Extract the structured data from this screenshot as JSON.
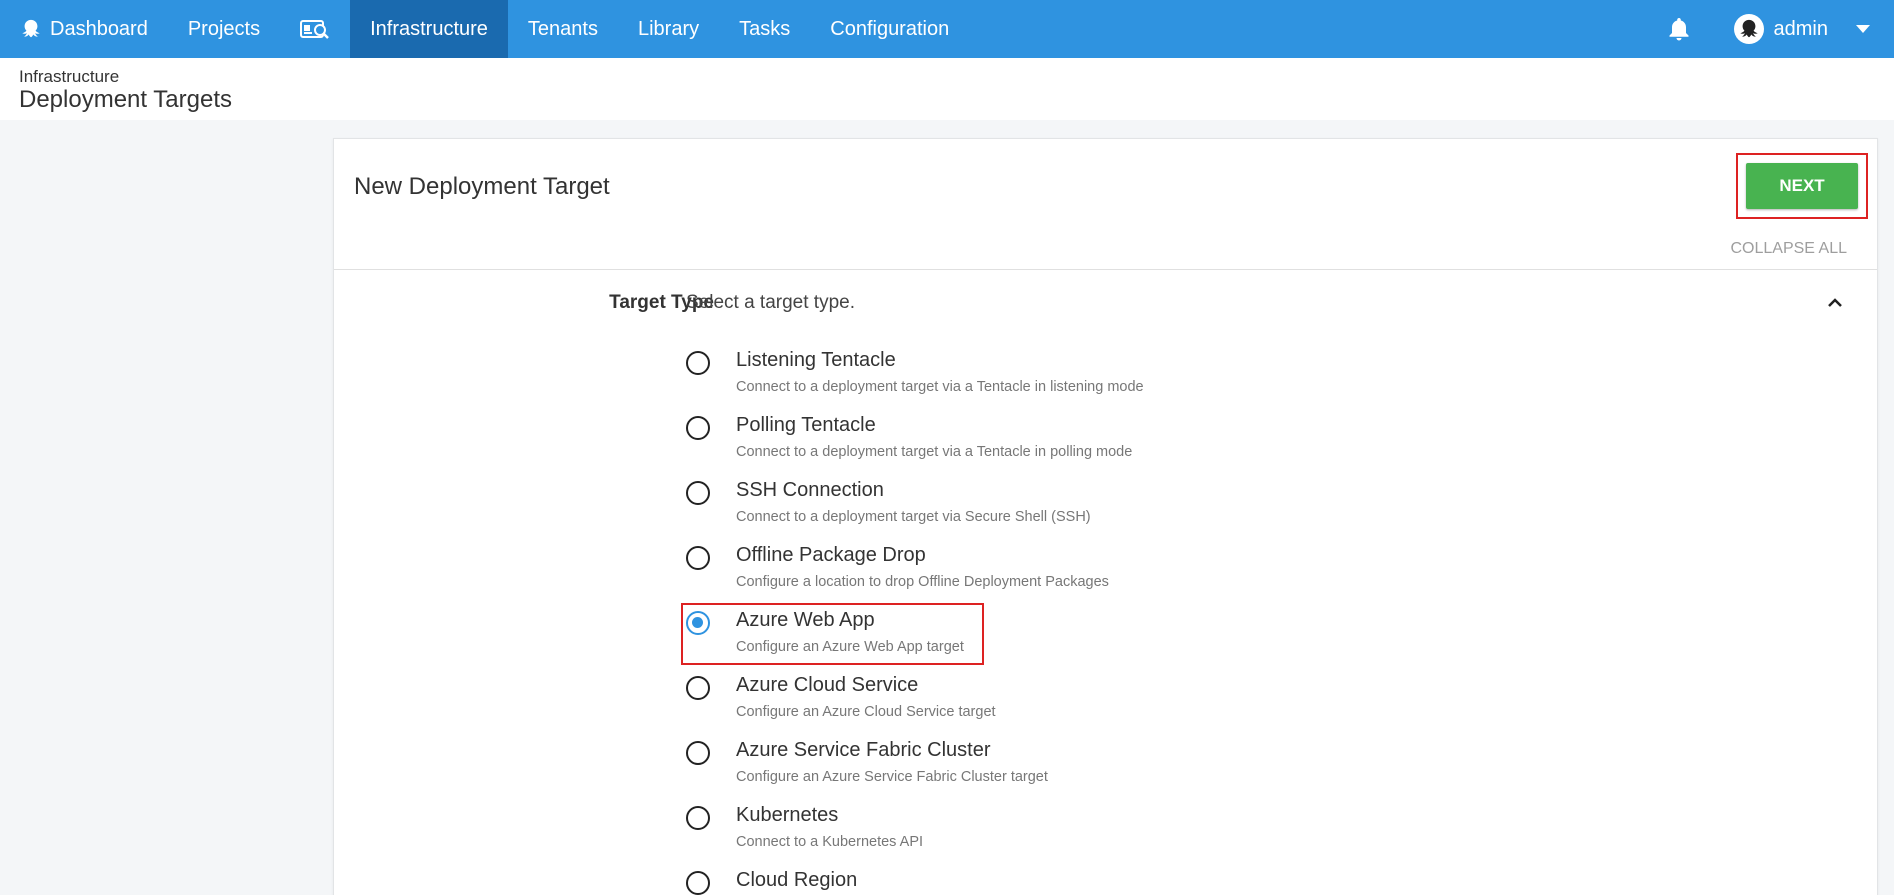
{
  "nav": {
    "items": [
      {
        "label": "Dashboard",
        "active": false
      },
      {
        "label": "Projects",
        "active": false
      },
      {
        "label": "Infrastructure",
        "active": true
      },
      {
        "label": "Tenants",
        "active": false
      },
      {
        "label": "Library",
        "active": false
      },
      {
        "label": "Tasks",
        "active": false
      },
      {
        "label": "Configuration",
        "active": false
      }
    ],
    "search_icon": "search-id-card-icon",
    "user": "admin",
    "bar_color": "#2f93e0",
    "active_color": "#1a6aaf"
  },
  "header": {
    "breadcrumb": "Infrastructure",
    "title": "Deployment Targets"
  },
  "card": {
    "title": "New Deployment Target",
    "next_label": "NEXT",
    "collapse_all_label": "COLLAPSE ALL",
    "section": {
      "label": "Target Type",
      "description": "Select a target type."
    },
    "options": [
      {
        "label": "Listening Tentacle",
        "description": "Connect to a deployment target via a Tentacle in listening mode",
        "selected": false
      },
      {
        "label": "Polling Tentacle",
        "description": "Connect to a deployment target via a Tentacle in polling mode",
        "selected": false
      },
      {
        "label": "SSH Connection",
        "description": "Connect to a deployment target via Secure Shell (SSH)",
        "selected": false
      },
      {
        "label": "Offline Package Drop",
        "description": "Configure a location to drop Offline Deployment Packages",
        "selected": false
      },
      {
        "label": "Azure Web App",
        "description": "Configure an Azure Web App target",
        "selected": true
      },
      {
        "label": "Azure Cloud Service",
        "description": "Configure an Azure Cloud Service target",
        "selected": false
      },
      {
        "label": "Azure Service Fabric Cluster",
        "description": "Configure an Azure Service Fabric Cluster target",
        "selected": false
      },
      {
        "label": "Kubernetes",
        "description": "Connect to a Kubernetes API",
        "selected": false
      },
      {
        "label": "Cloud Region",
        "description": "",
        "selected": false
      }
    ]
  },
  "colors": {
    "next_button": "#48b350",
    "radio_selected": "#2f93e0",
    "highlight_outline": "#dd2222"
  }
}
